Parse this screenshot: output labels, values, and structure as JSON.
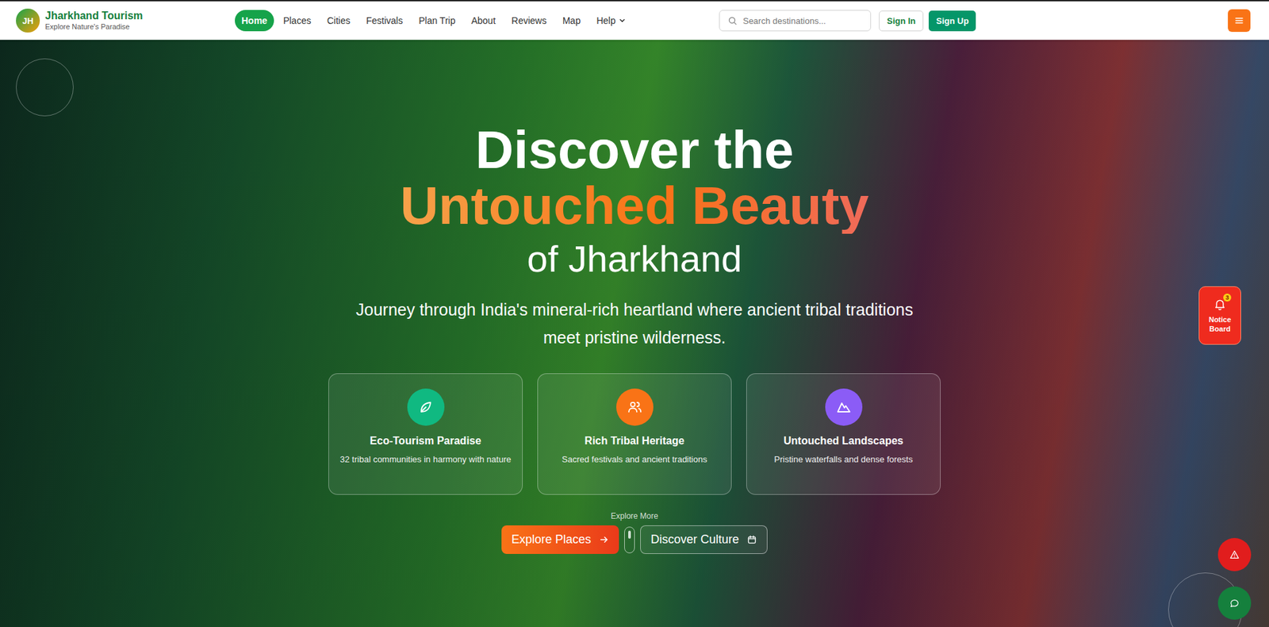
{
  "brand": {
    "logo": "JH",
    "title": "Jharkhand Tourism",
    "tagline": "Explore Nature's Paradise"
  },
  "nav": [
    {
      "label": "Home",
      "selected": true,
      "dropdown": false
    },
    {
      "label": "Places",
      "selected": false,
      "dropdown": false
    },
    {
      "label": "Cities",
      "selected": false,
      "dropdown": false
    },
    {
      "label": "Festivals",
      "selected": false,
      "dropdown": false
    },
    {
      "label": "Plan Trip",
      "selected": false,
      "dropdown": false
    },
    {
      "label": "About",
      "selected": false,
      "dropdown": false
    },
    {
      "label": "Reviews",
      "selected": false,
      "dropdown": false
    },
    {
      "label": "Map",
      "selected": false,
      "dropdown": false
    },
    {
      "label": "Help",
      "selected": false,
      "dropdown": true
    }
  ],
  "search": {
    "placeholder": "Search destinations..."
  },
  "auth": {
    "sign_in": "Sign In",
    "sign_up": "Sign Up"
  },
  "hero": {
    "line1": "Discover the",
    "highlight": "Untouched Beauty",
    "line3": "of Jharkhand",
    "subtitle": "Journey through India's mineral-rich heartland where ancient tribal traditions meet pristine wilderness."
  },
  "features": [
    {
      "title": "Eco-Tourism Paradise",
      "text": "32 tribal communities in harmony with nature",
      "color": "#10b981",
      "kind": "leaf"
    },
    {
      "title": "Rich Tribal Heritage",
      "text": "Sacred festivals and ancient traditions",
      "color": "#f97316",
      "kind": "people"
    },
    {
      "title": "Untouched Landscapes",
      "text": "Pristine waterfalls and dense forests",
      "color": "#8b5cf6",
      "kind": "mountain"
    }
  ],
  "explore_label": "Explore More",
  "buttons": [
    {
      "label": "Explore Places",
      "kind": "primary"
    },
    {
      "label": "Discover Culture",
      "kind": "outline"
    }
  ],
  "notice": {
    "label": "Notice Board",
    "count": "3"
  }
}
